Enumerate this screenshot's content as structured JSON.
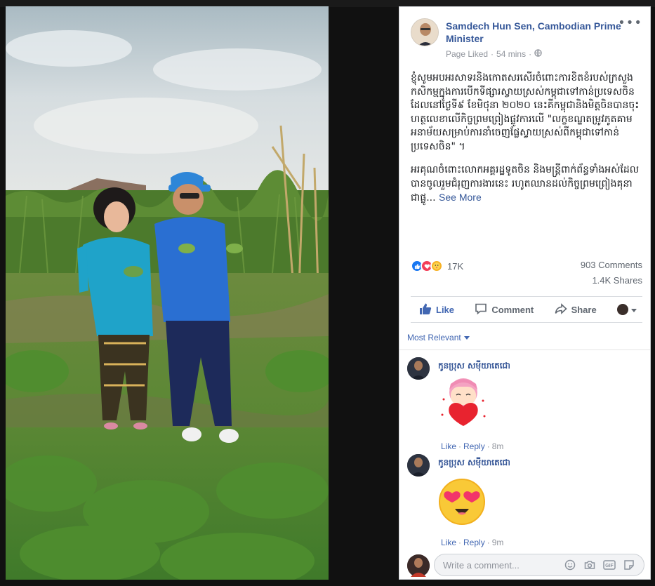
{
  "page": {
    "name": "Samdech Hun Sen, Cambodian Prime Minister",
    "liked_status": "Page Liked",
    "separator": "·",
    "time": "54 mins",
    "privacy_icon": "globe-icon"
  },
  "post": {
    "paragraph1": "ខ្ញុំសូមអបអរសាទរនិងកោតសរសើរចំពោះការខិតខំរបស់ក្រសួងកសិកម្មក្នុងការបើកទីផ្សារស្វាយស្រស់កម្ពុជាទៅកាន់ប្រទេសចិន ដែលនៅថ្ងៃទី៩ ខែមិថុនា ២០២០ នេះគីកម្ពុជានិងមិត្តចិនបានចុះហត្ថលេខាលើកិច្ចព្រមព្រៀងផ្លូវការលើ \"លក្ខខណ្ឌតម្រូវភូតគាមអនាម័យសម្រាប់ការនាំចេញផ្លែស្វាយស្រស់ពីកម្ពុជាទៅកាន់ប្រទេសចិន\" ។",
    "paragraph2": "អរគុណចំពោះលោកអគ្គរដ្ឋទូតចិន និងមន្ត្រីពាក់ព័ន្ធទាំងអស់ដែលបានចូលរួមជំរុញការងារនេះ រហូតឈានដល់កិច្ចព្រមព្រៀងគុនាជាផ្លូ...",
    "see_more": "See More"
  },
  "stats": {
    "reactions_count": "17K",
    "comments": "903 Comments",
    "shares": "1.4K Shares"
  },
  "actions": {
    "like": "Like",
    "comment": "Comment",
    "share": "Share"
  },
  "filter": {
    "label": "Most Relevant"
  },
  "comments": [
    {
      "author": "កូនប្រុស សម៉ីយាតេជោ",
      "sticker": "heart-girl-sticker",
      "like": "Like",
      "reply": "Reply",
      "time": "8m"
    },
    {
      "author": "កូនប្រុស សម៉ីយាតេជោ",
      "sticker": "heart-eyes-emoji",
      "like": "Like",
      "reply": "Reply",
      "time": "9m"
    }
  ],
  "composer": {
    "placeholder": "Write a comment..."
  },
  "colors": {
    "fb_blue": "#4267b2",
    "link_blue": "#365899",
    "muted": "#90949c",
    "love_red": "#f33e58"
  }
}
